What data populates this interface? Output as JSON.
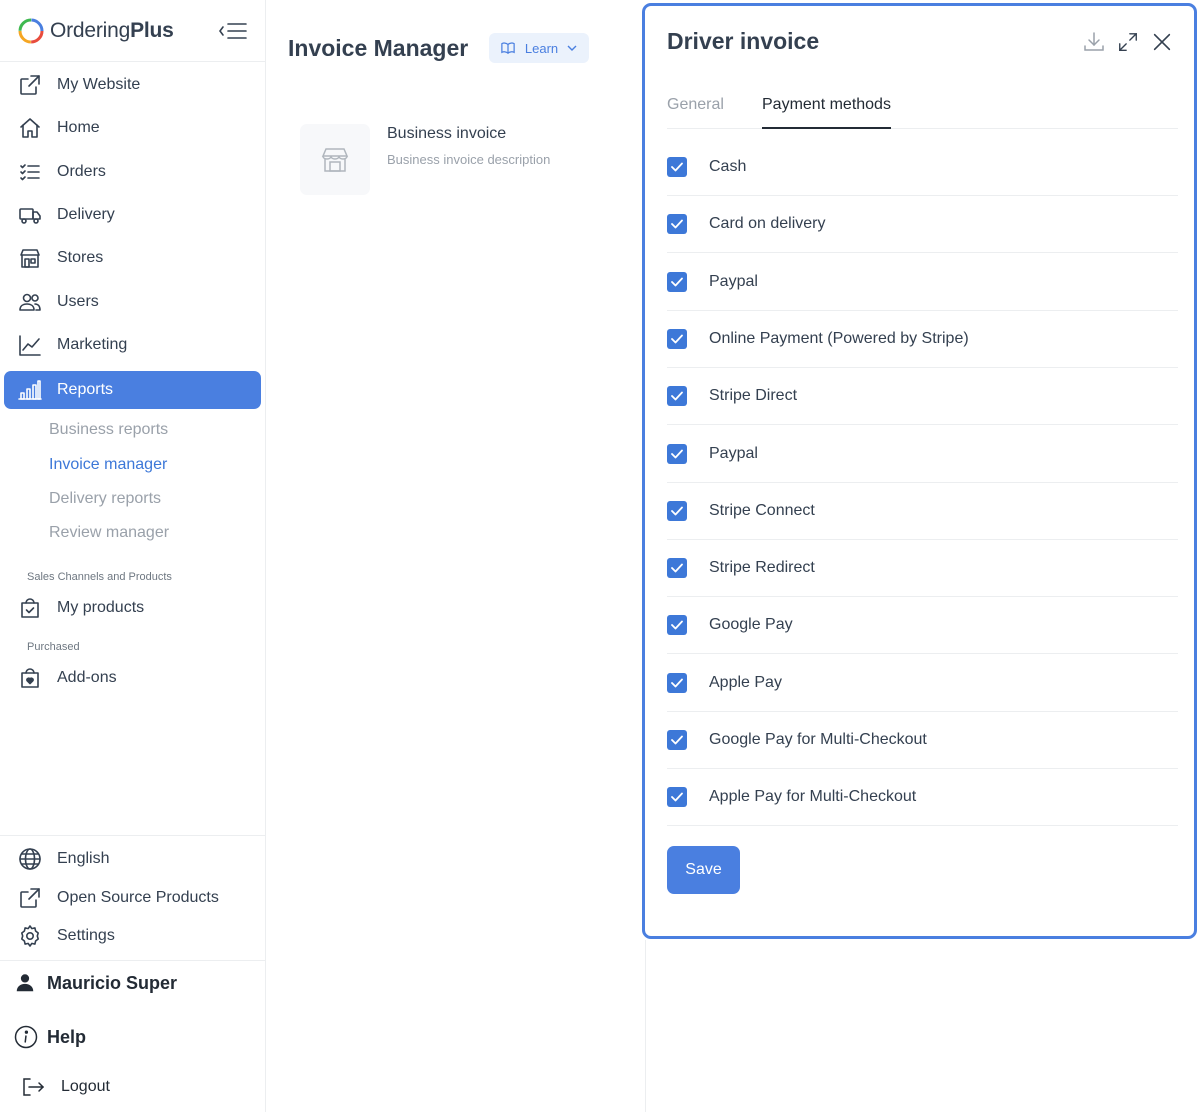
{
  "brand": {
    "name_regular": "Ordering",
    "name_bold": "Plus"
  },
  "sidebar": {
    "items": [
      {
        "label": "My Website",
        "icon": "external-link-icon"
      },
      {
        "label": "Home",
        "icon": "home-icon"
      },
      {
        "label": "Orders",
        "icon": "list-icon"
      },
      {
        "label": "Delivery",
        "icon": "truck-icon"
      },
      {
        "label": "Stores",
        "icon": "shop-icon"
      },
      {
        "label": "Users",
        "icon": "people-icon"
      },
      {
        "label": "Marketing",
        "icon": "graph-up-icon"
      },
      {
        "label": "Reports",
        "icon": "bar-chart-icon",
        "active": true
      }
    ],
    "report_subitems": [
      {
        "label": "Business reports"
      },
      {
        "label": "Invoice manager",
        "active": true
      },
      {
        "label": "Delivery reports"
      },
      {
        "label": "Review manager"
      }
    ],
    "section_sales": "Sales Channels and Products",
    "my_products": "My products",
    "section_purchased": "Purchased",
    "addons": "Add-ons",
    "bottom": {
      "language": "English",
      "open_source": "Open Source Products",
      "settings": "Settings",
      "user_name": "Mauricio Super",
      "help": "Help",
      "logout": "Logout"
    }
  },
  "main": {
    "title": "Invoice Manager",
    "learn_label": "Learn",
    "card": {
      "title": "Business invoice",
      "description": "Business invoice description"
    }
  },
  "panel": {
    "title": "Driver invoice",
    "tabs": [
      {
        "label": "General"
      },
      {
        "label": "Payment methods",
        "active": true
      }
    ],
    "payment_methods": [
      {
        "label": "Cash",
        "checked": true
      },
      {
        "label": "Card on delivery",
        "checked": true
      },
      {
        "label": "Paypal",
        "checked": true
      },
      {
        "label": "Online Payment (Powered by Stripe)",
        "checked": true
      },
      {
        "label": "Stripe Direct",
        "checked": true
      },
      {
        "label": "Paypal",
        "checked": true
      },
      {
        "label": "Stripe Connect",
        "checked": true
      },
      {
        "label": "Stripe Redirect",
        "checked": true
      },
      {
        "label": "Google Pay",
        "checked": true
      },
      {
        "label": "Apple Pay",
        "checked": true
      },
      {
        "label": "Google Pay for Multi-Checkout",
        "checked": true
      },
      {
        "label": "Apple Pay for Multi-Checkout",
        "checked": true
      }
    ],
    "save_label": "Save"
  },
  "colors": {
    "accent": "#4a7fe0",
    "text": "#344050",
    "muted": "#9aa1aa"
  }
}
